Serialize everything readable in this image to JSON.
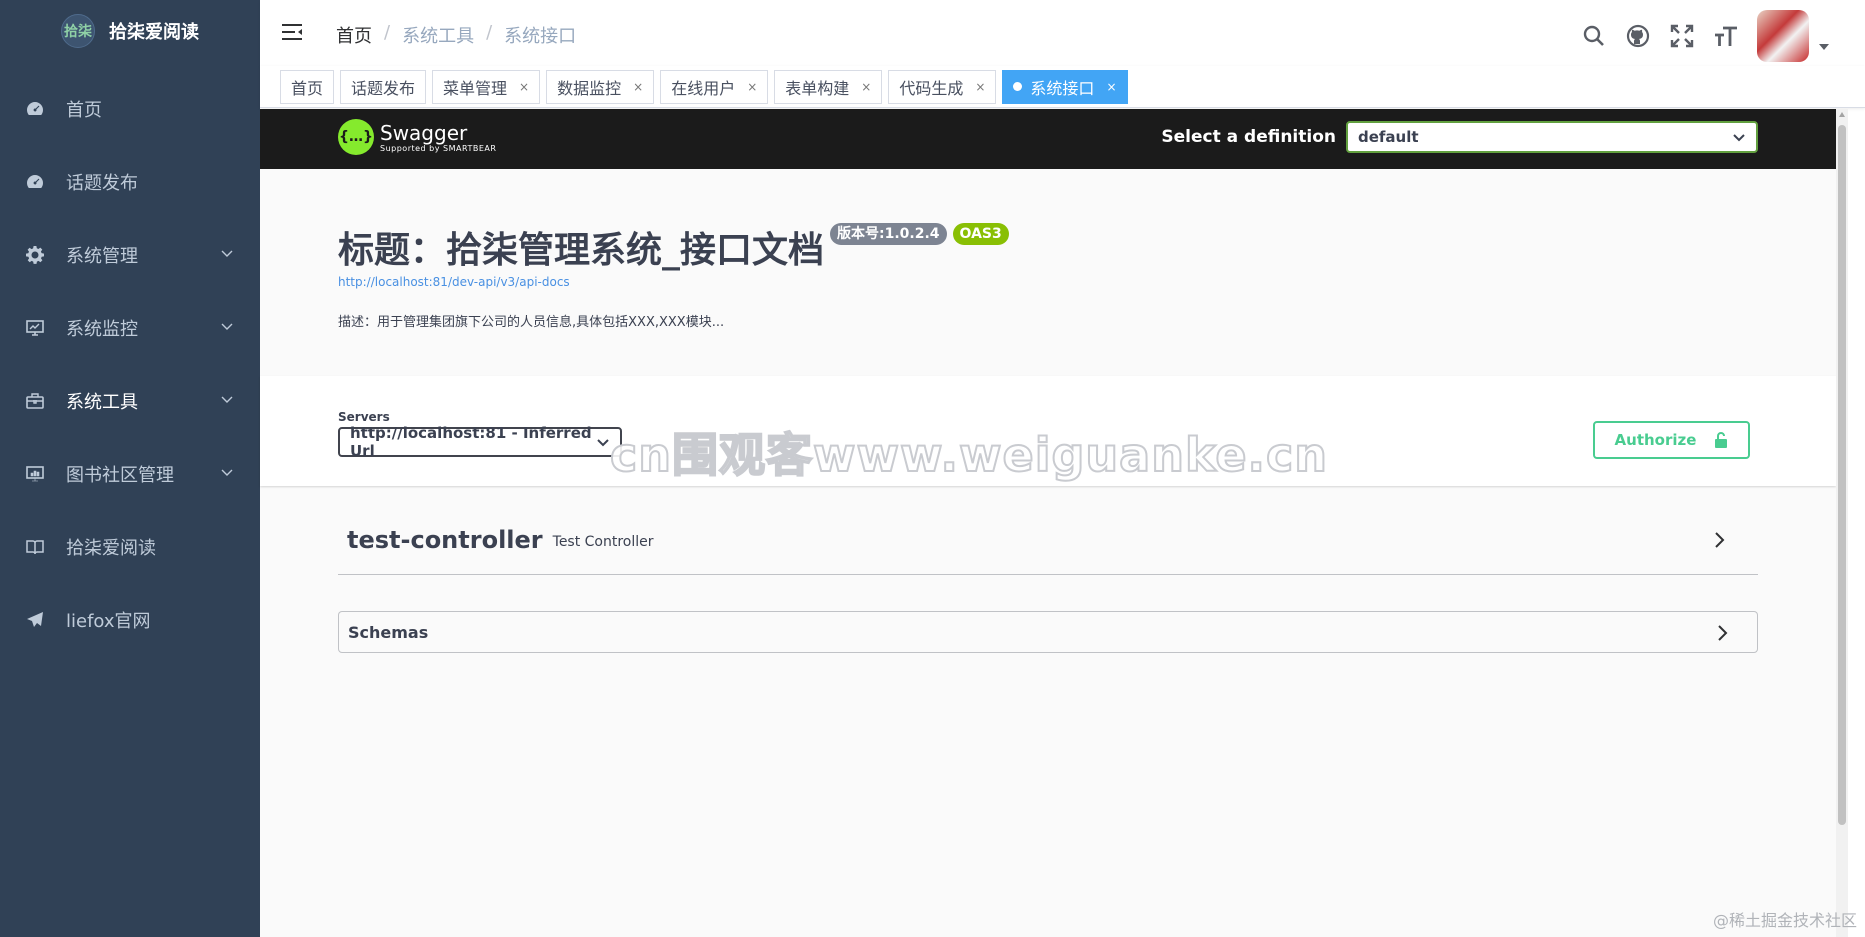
{
  "app": {
    "title": "拾柒爱阅读",
    "logo_text": "拾柒"
  },
  "sidebar": {
    "items": [
      {
        "label": "首页",
        "icon": "dashboard-icon",
        "has_children": false
      },
      {
        "label": "话题发布",
        "icon": "dashboard-icon",
        "has_children": false
      },
      {
        "label": "系统管理",
        "icon": "gear-icon",
        "has_children": true
      },
      {
        "label": "系统监控",
        "icon": "monitor-icon",
        "has_children": true
      },
      {
        "label": "系统工具",
        "icon": "toolbox-icon",
        "has_children": true
      },
      {
        "label": "图书社区管理",
        "icon": "book-community-icon",
        "has_children": true
      },
      {
        "label": "拾柒爱阅读",
        "icon": "book-icon",
        "has_children": false
      },
      {
        "label": "liefox官网",
        "icon": "paper-plane-icon",
        "has_children": false
      }
    ]
  },
  "breadcrumb": {
    "home": "首页",
    "level1": "系统工具",
    "level2": "系统接口"
  },
  "tags": [
    {
      "label": "首页",
      "closable": false,
      "active": false
    },
    {
      "label": "话题发布",
      "closable": false,
      "active": false
    },
    {
      "label": "菜单管理",
      "closable": true,
      "active": false
    },
    {
      "label": "数据监控",
      "closable": true,
      "active": false
    },
    {
      "label": "在线用户",
      "closable": true,
      "active": false
    },
    {
      "label": "表单构建",
      "closable": true,
      "active": false
    },
    {
      "label": "代码生成",
      "closable": true,
      "active": false
    },
    {
      "label": "系统接口",
      "closable": true,
      "active": true
    }
  ],
  "tag_close_glyph": "×",
  "swagger": {
    "logo_name": "Swagger",
    "logo_sub": "Supported by SMARTBEAR",
    "definition_label": "Select a definition",
    "definition_value": "default",
    "title": "标题：拾柒管理系统_接口文档",
    "version_badge": "版本号:1.0.2.4",
    "oas_badge": "OAS3",
    "url": "http://localhost:81/dev-api/v3/api-docs",
    "description": "描述：用于管理集团旗下公司的人员信息,具体包括XXX,XXX模块...",
    "servers_label": "Servers",
    "servers_value": "http://localhost:81 - Inferred Url",
    "authorize_label": "Authorize",
    "controller_name": "test-controller",
    "controller_desc": "Test Controller",
    "schemas_label": "Schemas"
  },
  "watermark": "cn围观客www.weiguanke.cn",
  "credit": "@稀土掘金技术社区",
  "colors": {
    "sidebar_bg": "#304156",
    "sidebar_text": "#bfcbd9",
    "active_tag": "#42a5f5",
    "swagger_green": "#85ea2d",
    "authorize_green": "#49cc90",
    "oas_badge": "#89bf04"
  }
}
